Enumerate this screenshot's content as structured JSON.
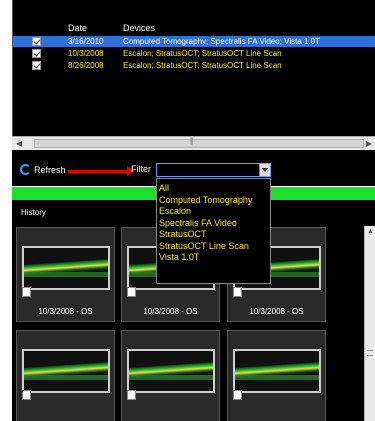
{
  "exams": {
    "columns": {
      "date": "Date",
      "devices": "Devices"
    },
    "rows": [
      {
        "date": "3/16/2010",
        "devices": "Computed Tomography; Spectralis FA Video; Vista 1.0T",
        "selected": true
      },
      {
        "date": "10/3/2008",
        "devices": "Escalon; StratusOCT; StratusOCT Line Scan",
        "selected": false
      },
      {
        "date": "8/26/2008",
        "devices": "Escalon; StratusOCT; StratusOCT Line Scan",
        "selected": false
      }
    ]
  },
  "toolbar": {
    "refresh_label": "Refresh",
    "filter_label": "Filter",
    "filter_value": ""
  },
  "filter_options": [
    "All",
    "Computed Tomography",
    "Escalon",
    "Spectralis FA Video",
    "StratusOCT",
    "StratusOCT Line Scan",
    "Vista 1.0T"
  ],
  "history": {
    "label": "History",
    "thumbnails": [
      {
        "caption": "10/3/2008 - OS"
      },
      {
        "caption": "10/3/2008 - OS"
      },
      {
        "caption": "10/3/2008 - OS"
      },
      {
        "caption": ""
      },
      {
        "caption": ""
      },
      {
        "caption": ""
      }
    ]
  },
  "colors": {
    "accent_green": "#19e02a",
    "selection_blue": "#2f6fd8",
    "list_text": "#ffef00",
    "annotation_arrow": "#e00000"
  }
}
